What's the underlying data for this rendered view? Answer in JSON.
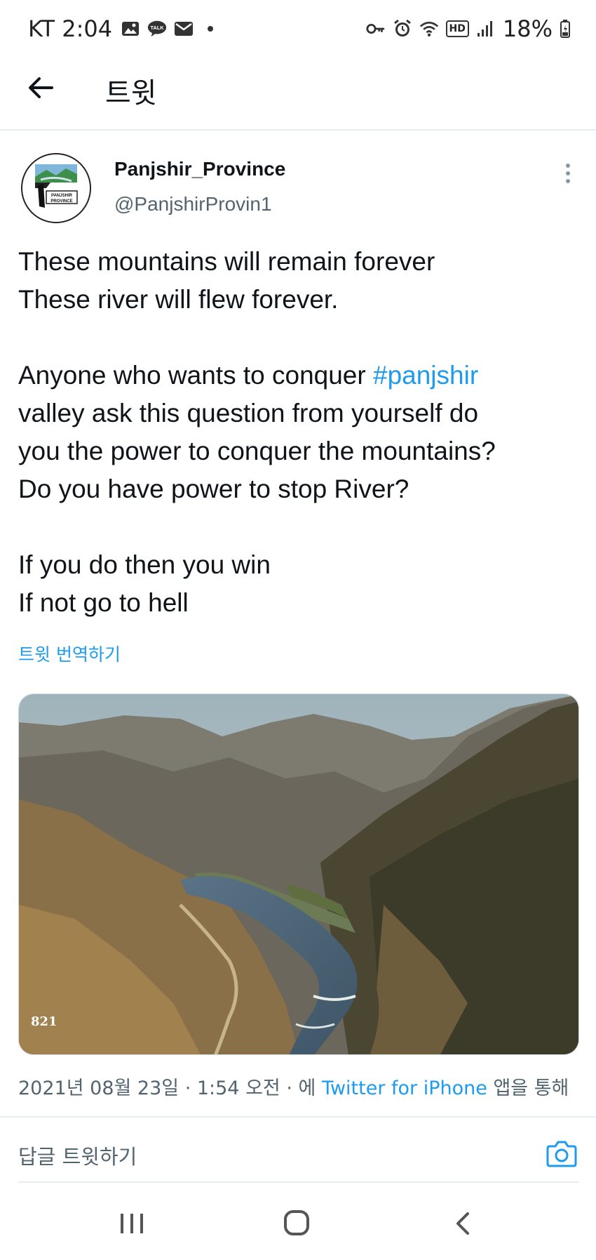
{
  "status_bar": {
    "carrier_time": "KT 2:04",
    "left_icons": [
      "image-icon",
      "talk-icon",
      "mail-icon",
      "dot-icon"
    ],
    "talk_badge": "TALK",
    "hd_badge": "HD",
    "battery": "18%",
    "right_icons": [
      "key-icon",
      "alarm-icon",
      "wifi-icon",
      "hd-icon",
      "signal-icon",
      "battery-icon"
    ]
  },
  "header": {
    "title": "트윗"
  },
  "tweet": {
    "author_name": "Panjshir_Province",
    "handle": "@PanjshirProvin1",
    "avatar_text": "PANJSHIR PROVINCE",
    "lines": {
      "l1": "These mountains will remain forever",
      "l2": "These river will flew forever.",
      "l3_before": "Anyone who wants to conquer ",
      "hashtag": "#panjshir",
      "l4": "valley ask this question from yourself do",
      "l5": "you the power to conquer the mountains?",
      "l6": "Do you have power to stop River?",
      "l7": "If you do then you win",
      "l8": "If not go to hell"
    },
    "translate_label": "트윗 번역하기",
    "media_number": "821",
    "meta": {
      "date_time": "2021년 08월 23일 · 1:54 오전 · 에 ",
      "source": "Twitter for iPhone",
      "suffix": " 앱을 통해"
    }
  },
  "reply": {
    "placeholder": "답글 트윗하기"
  },
  "colors": {
    "accent": "#1d9bf0",
    "secondary_text": "#536471",
    "divider": "#e6ecf0"
  }
}
